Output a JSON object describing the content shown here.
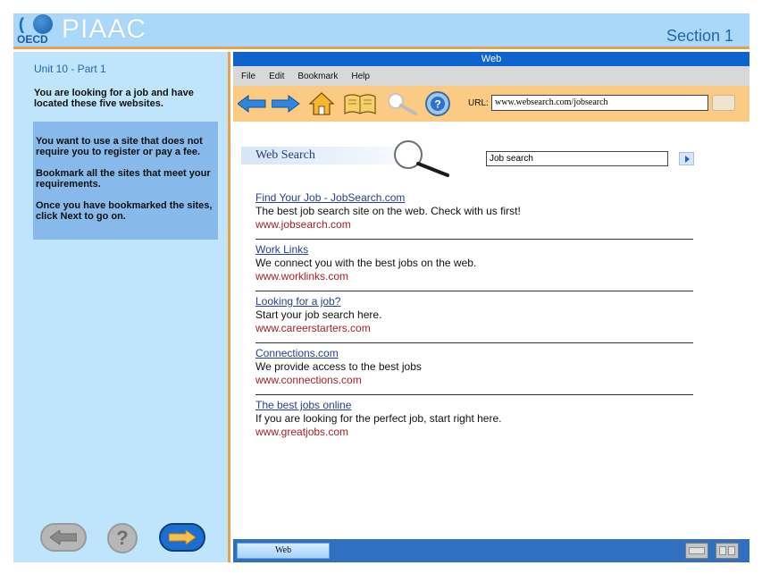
{
  "header": {
    "logo_oecd": "OECD",
    "logo_piaac": "PIAAC",
    "section": "Section 1"
  },
  "left_panel": {
    "unit_title": "Unit 10 - Part 1",
    "intro": "You are looking for a job and have located these five websites.",
    "instructions": [
      "You want to use a site that does not require you to register or pay a fee.",
      "Bookmark all the sites that meet your requirements.",
      "Once you have bookmarked the sites, click Next to go on."
    ],
    "help_label": "?"
  },
  "browser": {
    "title": "Web",
    "menu": [
      "File",
      "Edit",
      "Bookmark",
      "Help"
    ],
    "url_label": "URL:",
    "url_value": "www.websearch.com/jobsearch",
    "banner": "Web Search",
    "search_value": "Job search",
    "results": [
      {
        "title": "Find Your Job - JobSearch.com",
        "desc": "The best job search site on the web.  Check with us first!",
        "url": "www.jobsearch.com"
      },
      {
        "title": "Work Links",
        "desc": "We connect you with the best jobs on the web.",
        "url": "www.worklinks.com"
      },
      {
        "title": "Looking for a job?",
        "desc": "Start your job search here.",
        "url": "www.careerstarters.com"
      },
      {
        "title": "Connections.com",
        "desc": "We provide access to the best jobs",
        "url": "www.connections.com"
      },
      {
        "title": "The best jobs online",
        "desc": "If you are looking for the perfect job, start right here.",
        "url": "www.greatjobs.com"
      }
    ],
    "task_tab": "Web"
  },
  "colors": {
    "header_bg": "#a9d8fb",
    "left_bg": "#bfe5fd",
    "accent_orange": "#e9a24b",
    "browser_title": "#0f63cf",
    "toolbar": "#fbcb84",
    "link": "#24408f",
    "url_red": "#a51d2b"
  },
  "icons": [
    "back-arrow-icon",
    "forward-arrow-icon",
    "home-icon",
    "bookmark-book-icon",
    "search-magnifier-icon",
    "help-icon"
  ]
}
